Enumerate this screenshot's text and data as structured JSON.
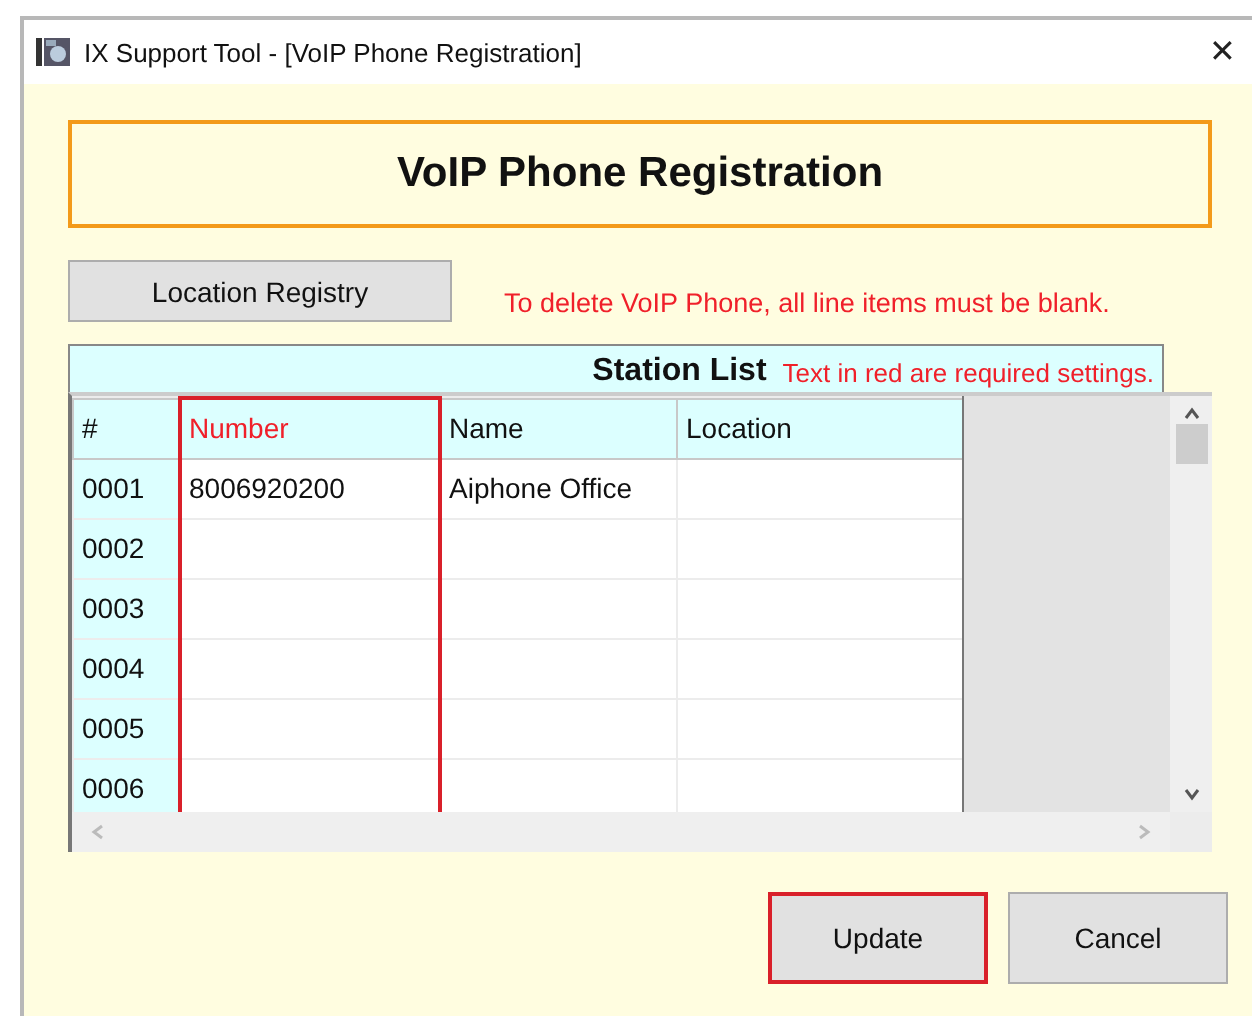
{
  "window": {
    "title": "IX Support Tool - [VoIP Phone Registration]",
    "close": "✕"
  },
  "header": {
    "title": "VoIP Phone Registration"
  },
  "location_button": {
    "label": "Location Registry"
  },
  "delete_note": "To delete VoIP Phone, all line items must be blank.",
  "station_list": {
    "title": "Station List",
    "note": "Text in red are required settings.",
    "columns": [
      {
        "kind": "index",
        "label": "#",
        "required": false,
        "highlighted": false
      },
      {
        "kind": "number",
        "label": "Number",
        "required": true,
        "highlighted": true
      },
      {
        "kind": "name",
        "label": "Name",
        "required": false,
        "highlighted": false
      },
      {
        "kind": "location",
        "label": "Location",
        "required": false,
        "highlighted": false
      }
    ],
    "rows": [
      {
        "index": "0001",
        "number": "8006920200",
        "name": "Aiphone Office"
      },
      {
        "index": "0002"
      },
      {
        "index": "0003"
      },
      {
        "index": "0004"
      },
      {
        "index": "0005"
      },
      {
        "index": "0006"
      }
    ]
  },
  "buttons": [
    {
      "label": "Update",
      "highlighted": true
    },
    {
      "label": "Cancel",
      "highlighted": false
    }
  ]
}
